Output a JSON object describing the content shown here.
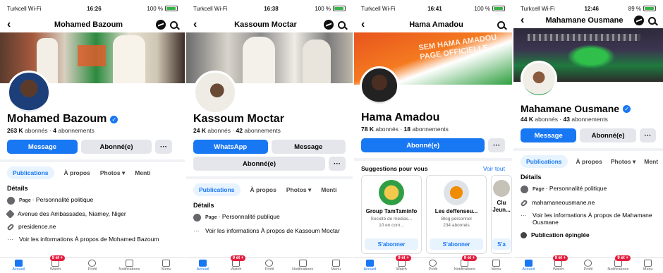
{
  "panels": [
    {
      "status_left": "Turkcell Wi-Fi",
      "time": "16:26",
      "battery": "100 %",
      "title": "Mohamed Bazoum",
      "name": "Mohamed Bazoum",
      "followers": "263 K",
      "followers_label": "abonnés",
      "following": "4",
      "following_label": "abonnements",
      "btn1": "Message",
      "btn2": "Abonné(e)",
      "more": "···",
      "tabs": [
        "Publications",
        "À propos",
        "Photos ▾",
        "Menti"
      ],
      "section": "Détails",
      "details": [
        {
          "tag": "Page",
          "text": "· Personnalité politique"
        },
        {
          "tag": "",
          "text": "Avenue des Ambassades, Niamey, Niger"
        },
        {
          "tag": "",
          "text": "presidence.ne"
        },
        {
          "tag": "",
          "text": "Voir les informations À propos de Mohamed Bazoum"
        }
      ]
    },
    {
      "status_left": "Turkcell Wi-Fi",
      "time": "16:38",
      "battery": "100 %",
      "title": "Kassoum Moctar",
      "name": "Kassoum Moctar",
      "followers": "24 K",
      "followers_label": "abonnés",
      "following": "42",
      "following_label": "abonnements",
      "btn1": "WhatsApp",
      "btn2": "Message",
      "btn3": "Abonné(e)",
      "more": "···",
      "tabs": [
        "Publications",
        "À propos",
        "Photos ▾",
        "Menti"
      ],
      "section": "Détails",
      "details": [
        {
          "tag": "Page",
          "text": "· Personnalité publique"
        },
        {
          "tag": "",
          "text": "Voir les informations À propos de Kassoum Moctar"
        }
      ]
    },
    {
      "status_left": "Turkcell Wi-Fi",
      "time": "16:41",
      "battery": "100 %",
      "title": "Hama Amadou",
      "name": "Hama Amadou",
      "followers": "78 K",
      "followers_label": "abonnés",
      "following": "18",
      "following_label": "abonnements",
      "btn1": "Abonné(e)",
      "more": "···",
      "cover_text": "SEM HAMA AMADOU PAGE OFFICIELLE",
      "sugg_title": "Suggestions pour vous",
      "sugg_link": "Voir tout",
      "cards": [
        {
          "name": "Group TamTaminfo",
          "sub": "Société de médias...",
          "sub2": "10 en com...",
          "btn": "S'abonner"
        },
        {
          "name": "Les deffenseu...",
          "sub": "Blog personnel",
          "sub2": "234 abonnés",
          "btn": "S'abonner"
        },
        {
          "name": "Clu Jeun...",
          "sub": "",
          "sub2": "",
          "btn": "S'a"
        }
      ]
    },
    {
      "status_left": "Turkcell Wi-Fi",
      "time": "12:46",
      "battery": "89 %",
      "title": "Mahamane Ousmane",
      "name": "Mahamane Ousmane",
      "followers": "44 K",
      "followers_label": "abonnés",
      "following": "43",
      "following_label": "abonnements",
      "btn1": "Message",
      "btn2": "Abonné(e)",
      "more": "···",
      "tabs": [
        "Publications",
        "À propos",
        "Photos ▾",
        "Ment"
      ],
      "section": "Détails",
      "details": [
        {
          "tag": "Page",
          "text": "· Personnalité politique"
        },
        {
          "tag": "",
          "text": "mahamaneousmane.ne"
        },
        {
          "tag": "",
          "text": "Voir les informations À propos de Mahamane Ousmane"
        },
        {
          "tag": "",
          "text": "Publication épinglée"
        }
      ]
    }
  ],
  "nav": {
    "home": "Accueil",
    "watch": "Watch",
    "profile": "Profil",
    "notifications": "Notifications",
    "menu": "Menu",
    "badge": "9 et +"
  },
  "colors": {
    "accent": "#1877f2",
    "badge": "#e41e3f"
  }
}
